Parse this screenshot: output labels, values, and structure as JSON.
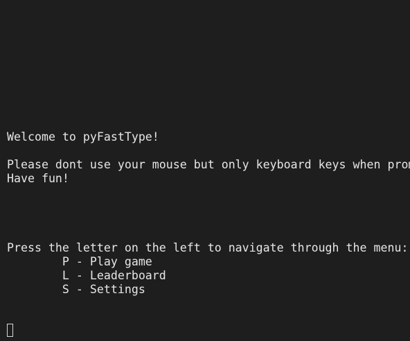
{
  "terminal": {
    "welcome": "Welcome to pyFastType!",
    "instruction": "Please dont use your mouse but only keyboard keys when prom",
    "have_fun": "Have fun!",
    "menu_prompt": "Press the letter on the left to navigate through the menu:",
    "menu_items": [
      "        P - Play game",
      "        L - Leaderboard",
      "        S - Settings"
    ]
  }
}
